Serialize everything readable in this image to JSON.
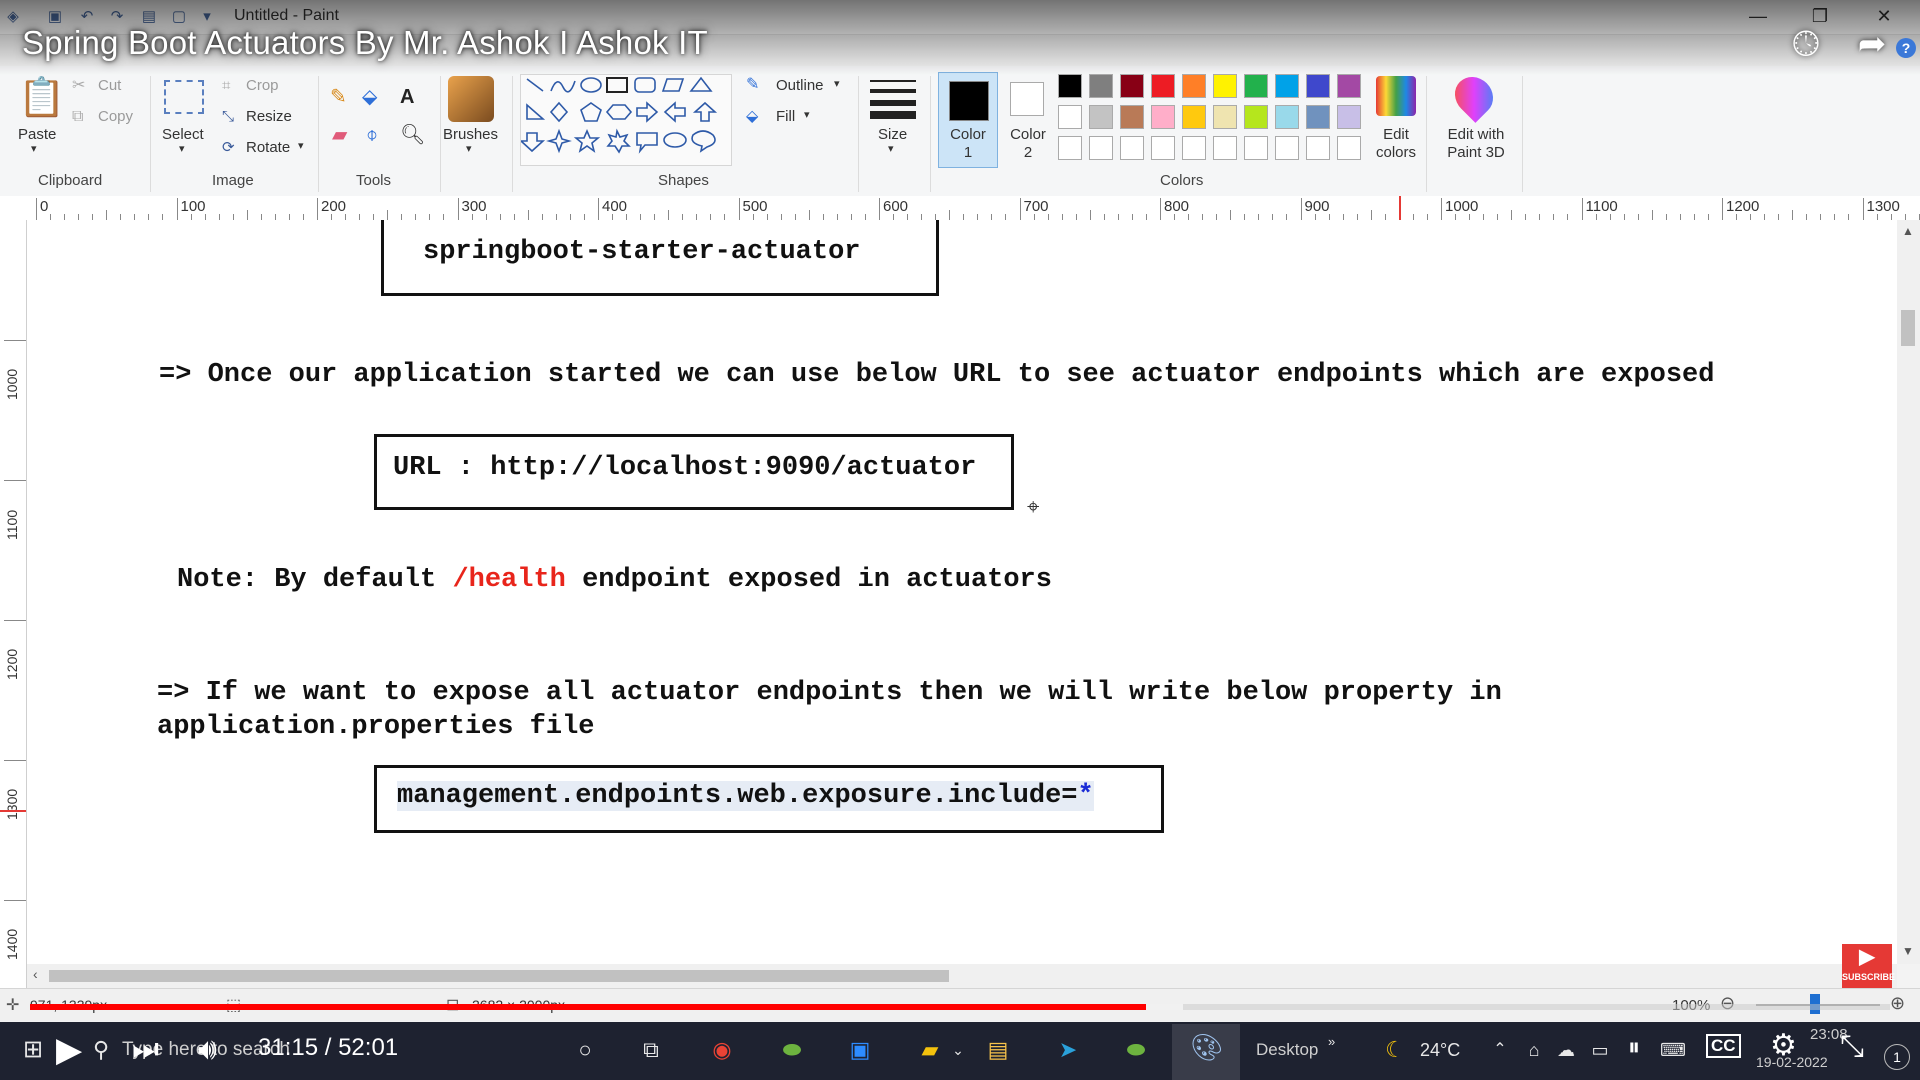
{
  "window": {
    "title": "Untitled - Paint"
  },
  "video": {
    "title": "Spring Boot Actuators By Mr. Ashok I Ashok IT",
    "time_current": "31:15",
    "time_separator": "/",
    "time_total": "52:01",
    "progress_fraction": 0.5998,
    "buffered_fraction": 0.62
  },
  "ribbon": {
    "clipboard": {
      "paste": "Paste",
      "cut": "Cut",
      "copy": "Copy",
      "label": "Clipboard"
    },
    "image": {
      "select": "Select",
      "crop": "Crop",
      "resize": "Resize",
      "rotate": "Rotate",
      "label": "Image"
    },
    "tools": {
      "label": "Tools"
    },
    "brushes": "Brushes",
    "shapes": {
      "outline": "Outline",
      "fill": "Fill",
      "label": "Shapes"
    },
    "size": "Size",
    "color1": "Color 1",
    "color2": "Color 2",
    "colors_label": "Colors",
    "edit_colors": "Edit colors",
    "edit_paint3d": "Edit with Paint 3D",
    "palette_row1": [
      "#000000",
      "#7f7f7f",
      "#880015",
      "#ed1c24",
      "#ff7f27",
      "#fff200",
      "#22b14c",
      "#00a2e8",
      "#3f48cc",
      "#a349a4"
    ],
    "palette_row2": [
      "#ffffff",
      "#c3c3c3",
      "#b97a57",
      "#ffaec9",
      "#ffc90e",
      "#efe4b0",
      "#b5e61d",
      "#99d9ea",
      "#7092be",
      "#c8bfe7"
    ],
    "palette_row3": [
      "#ffffff",
      "#ffffff",
      "#ffffff",
      "#ffffff",
      "#ffffff",
      "#ffffff",
      "#ffffff",
      "#ffffff",
      "#ffffff",
      "#ffffff"
    ]
  },
  "ruler": {
    "h_labels": [
      "0",
      "100",
      "200",
      "300",
      "400",
      "500",
      "600",
      "700",
      "800",
      "900",
      "1000",
      "1100",
      "1200",
      "1300"
    ],
    "v_labels": [
      "1000",
      "1100",
      "1200",
      "1300",
      "1400"
    ]
  },
  "canvas": {
    "box1_text": "springboot-starter-actuator",
    "line1": "=> Once our application started we can use below URL to see actuator endpoints which are exposed",
    "url_box": "URL : http://localhost:9090/actuator",
    "note_prefix": "Note: By default ",
    "note_highlight": "/health",
    "note_suffix": " endpoint exposed in actuators",
    "line2a": "=> If we want to expose all actuator endpoints then we will write below property in",
    "line2b": "application.properties file",
    "prop_text": "management.endpoints.web.exposure.include=",
    "prop_star": "*",
    "highlight_color": "#e8251b",
    "star_color": "#1a2bd6"
  },
  "statusbar": {
    "cursor_pos": "971, 1339px",
    "size": "2682 × 2000px",
    "zoom": "100%"
  },
  "taskbar": {
    "search_placeholder": "Type here to search",
    "desktop": "Desktop",
    "temperature": "24°C",
    "time": "23:08",
    "date": "19-02-2022"
  }
}
